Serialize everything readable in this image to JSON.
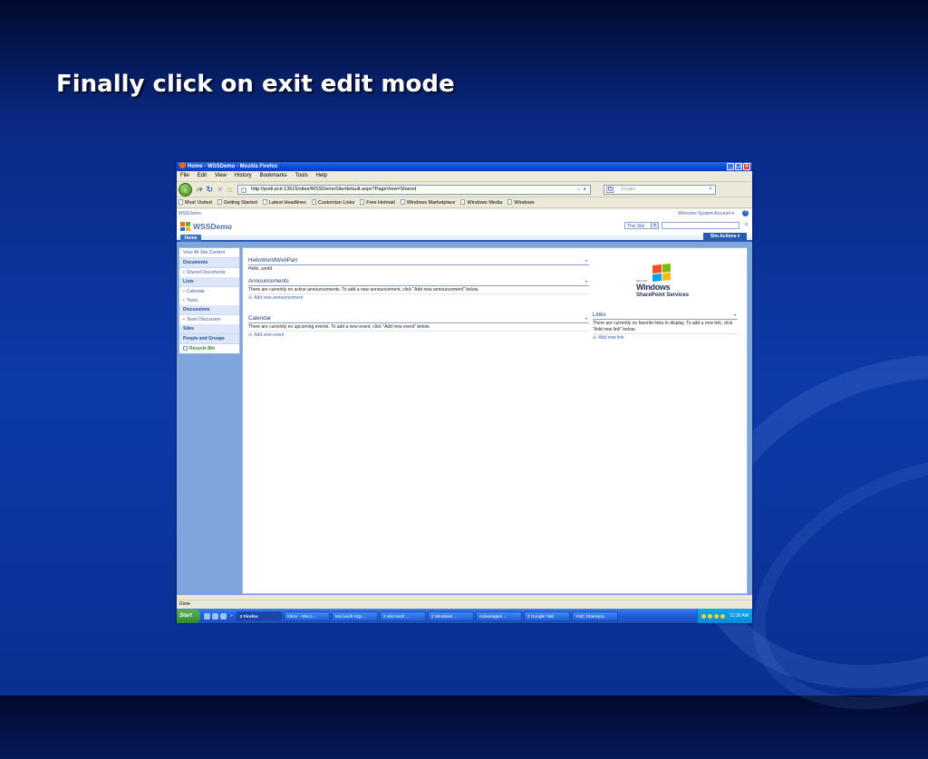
{
  "slide": {
    "title": "Finally click on exit edit mode"
  },
  "window": {
    "title": "Home - WSSDemo - Mozilla Firefox"
  },
  "menu": [
    "File",
    "Edit",
    "View",
    "History",
    "Bookmarks",
    "Tools",
    "Help"
  ],
  "nav": {
    "url": "http://podi-pcti:13615/sites/WSSDemoSite/default.aspx?PageView=Shared",
    "search_placeholder": "Google"
  },
  "bookmarks": [
    "Most Visited",
    "Getting Started",
    "Latest Headlines",
    "Customize Links",
    "Free Hotmail",
    "Windows Marketplace",
    "Windows Media",
    "Windows"
  ],
  "sharepoint": {
    "breadcrumb": "WSSDemo",
    "welcome": "Welcome System Account ▾",
    "site_name": "WSSDemo",
    "scope": "This Site",
    "tab_home": "Home",
    "site_actions": "Site Actions ▾",
    "quicklaunch": {
      "view_all": "View All Site Content",
      "documents": "Documents",
      "shared_documents": "Shared Documents",
      "lists": "Lists",
      "calendar": "Calendar",
      "tasks": "Tasks",
      "discussions": "Discussions",
      "team_discussion": "Team Discussion",
      "sites": "Sites",
      "people_groups": "People and Groups",
      "recycle_bin": "Recycle Bin"
    },
    "webparts": {
      "hello": {
        "title": "HelloWorldWebPart",
        "body": "Hello, world"
      },
      "announcements": {
        "title": "Announcements",
        "body": "There are currently no active announcements. To add a new announcement, click \"Add new announcement\" below.",
        "add": "Add new announcement"
      },
      "calendar": {
        "title": "Calendar",
        "body": "There are currently no upcoming events. To add a new event, click \"Add new event\" below.",
        "add": "Add new event"
      },
      "links": {
        "title": "Links",
        "body": "There are currently no favorite links to display. To add a new link, click \"Add new link\" below.",
        "add": "Add new link"
      }
    },
    "logo": {
      "ms": "Microsoft",
      "windows": "Windows",
      "services": "SharePoint Services"
    }
  },
  "status": "Done",
  "taskbar": {
    "start": "Start",
    "tasks": [
      "2 Firefox",
      "Inbox - Micro...",
      "Microsoft SQL...",
      "3 Microsoft ...",
      "2 Windows ...",
      "Advantages ...",
      "3 Google Talk",
      "YMC Sharepoi..."
    ],
    "clock": "11:36 AM"
  }
}
